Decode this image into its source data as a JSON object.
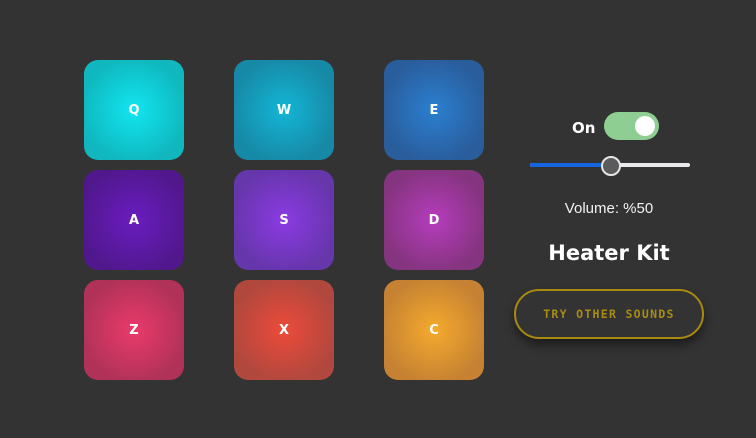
{
  "pads": [
    {
      "key": "Q",
      "center": "#11e6f0",
      "edge": "#10b7bf"
    },
    {
      "key": "W",
      "center": "#14b6d6",
      "edge": "#1689a6"
    },
    {
      "key": "E",
      "center": "#2a7fd0",
      "edge": "#2a5d9c"
    },
    {
      "key": "A",
      "center": "#6a1cc0",
      "edge": "#51188e"
    },
    {
      "key": "S",
      "center": "#8b3ae3",
      "edge": "#6636ab"
    },
    {
      "key": "D",
      "center": "#b63cbd",
      "edge": "#85347f"
    },
    {
      "key": "Z",
      "center": "#ea3a6a",
      "edge": "#b03258"
    },
    {
      "key": "X",
      "center": "#ec4a3a",
      "edge": "#b0483e"
    },
    {
      "key": "C",
      "center": "#f5aa2e",
      "edge": "#c68232"
    }
  ],
  "controls": {
    "power_label": "On",
    "power_on": true,
    "volume_fraction": 0.5,
    "volume_text": "Volume: %50",
    "kit_name": "Heater Kit",
    "switch_button": "TRY OTHER SOUNDS"
  },
  "colors": {
    "background": "#333333",
    "toggle_on": "#8fce92",
    "slider_fill": "#1565e0",
    "button_border": "#a88a10"
  }
}
